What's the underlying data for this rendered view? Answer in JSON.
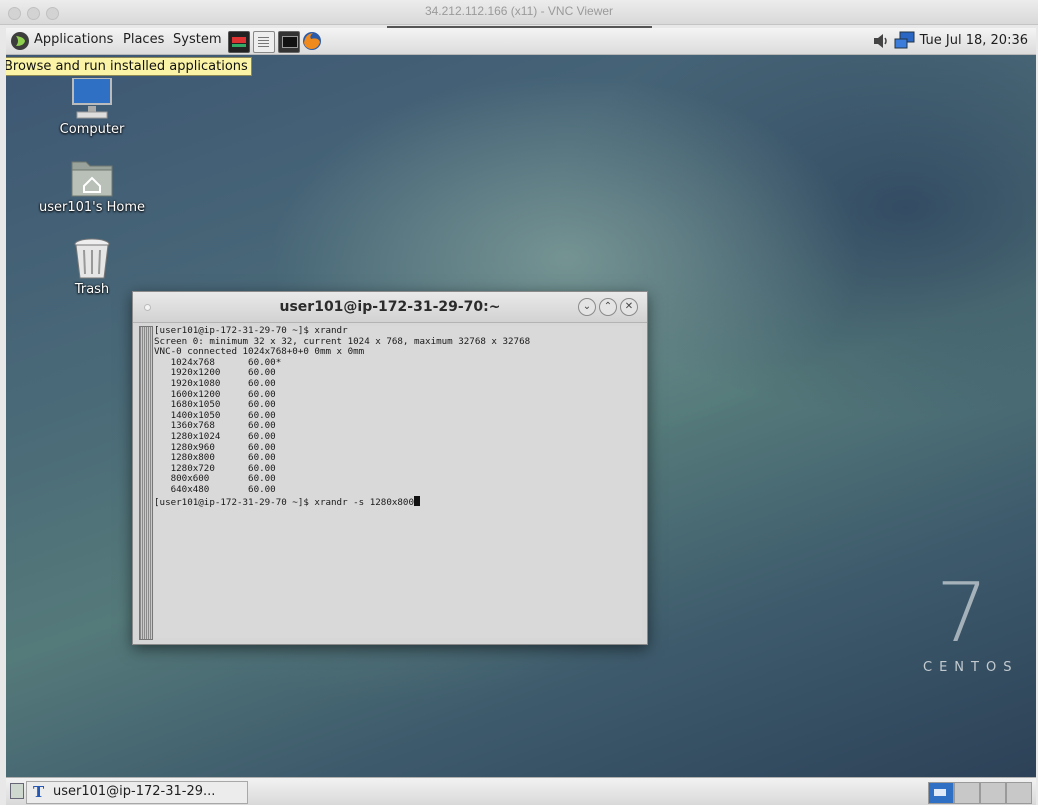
{
  "vnc": {
    "title": "34.212.112.166 (x11) - VNC Viewer"
  },
  "panel": {
    "applications": "Applications",
    "places": "Places",
    "system": "System",
    "clock": "Tue Jul 18, 20:36"
  },
  "tooltip": "Browse and run installed applications",
  "desktop_icons": {
    "computer": "Computer",
    "home": "user101's Home",
    "trash": "Trash"
  },
  "terminal": {
    "title": "user101@ip-172-31-29-70:~",
    "lines": [
      "[user101@ip-172-31-29-70 ~]$ xrandr",
      "Screen 0: minimum 32 x 32, current 1024 x 768, maximum 32768 x 32768",
      "VNC-0 connected 1024x768+0+0 0mm x 0mm",
      "   1024x768      60.00*",
      "   1920x1200     60.00",
      "   1920x1080     60.00",
      "   1600x1200     60.00",
      "   1680x1050     60.00",
      "   1400x1050     60.00",
      "   1360x768      60.00",
      "   1280x1024     60.00",
      "   1280x960      60.00",
      "   1280x800      60.00",
      "   1280x720      60.00",
      "   800x600       60.00",
      "   640x480       60.00"
    ],
    "prompt_line": "[user101@ip-172-31-29-70 ~]$ xrandr -s 1280x800"
  },
  "branding": {
    "number": "7",
    "word": "CENTOS"
  },
  "taskbar": {
    "item": "user101@ip-172-31-29..."
  }
}
